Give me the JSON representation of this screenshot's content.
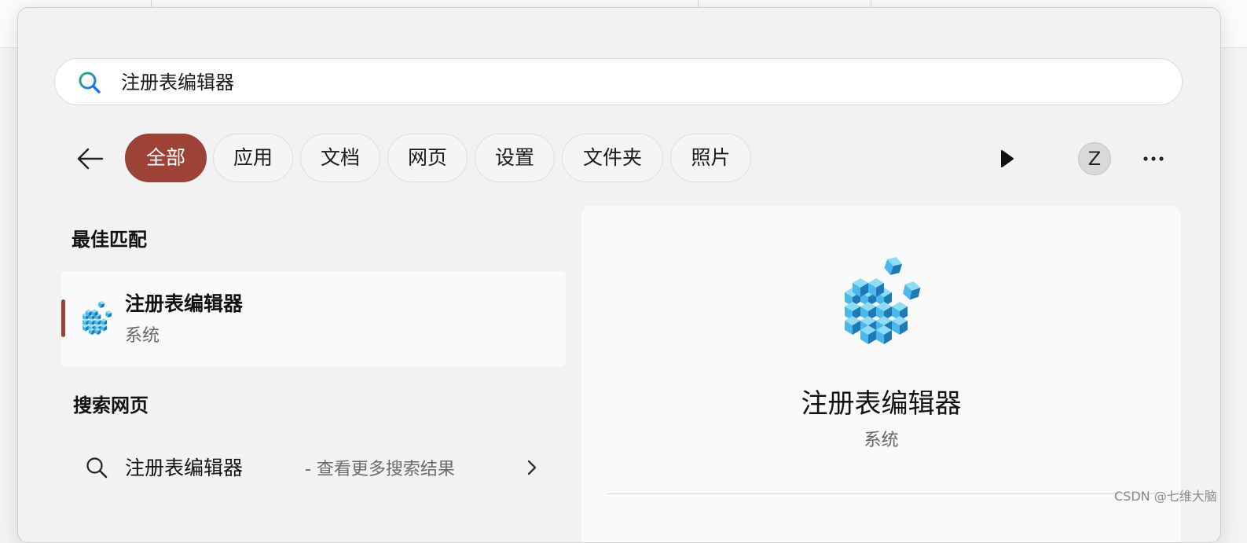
{
  "search": {
    "query": "注册表编辑器"
  },
  "filters": {
    "tabs": [
      {
        "label": "全部",
        "active": true
      },
      {
        "label": "应用",
        "active": false
      },
      {
        "label": "文档",
        "active": false
      },
      {
        "label": "网页",
        "active": false
      },
      {
        "label": "设置",
        "active": false
      },
      {
        "label": "文件夹",
        "active": false
      },
      {
        "label": "照片",
        "active": false
      }
    ],
    "avatar_initial": "Z"
  },
  "best_match": {
    "section_title": "最佳匹配",
    "app_name": "注册表编辑器",
    "app_type": "系统"
  },
  "web_search": {
    "section_title": "搜索网页",
    "query": "注册表编辑器",
    "hint": "- 查看更多搜索结果"
  },
  "detail": {
    "app_name": "注册表编辑器",
    "app_type": "系统"
  },
  "watermark": "CSDN @七维大脑",
  "colors": {
    "accent": "#9c4237",
    "icon_cube_light": "#58c4ee",
    "icon_cube_dark": "#1f79b5"
  },
  "icons": {
    "search": "search-icon",
    "back": "arrow-left-icon",
    "play": "play-icon",
    "more": "more-horizontal-icon",
    "registry": "registry-editor-icon",
    "chevron": "chevron-right-icon"
  }
}
